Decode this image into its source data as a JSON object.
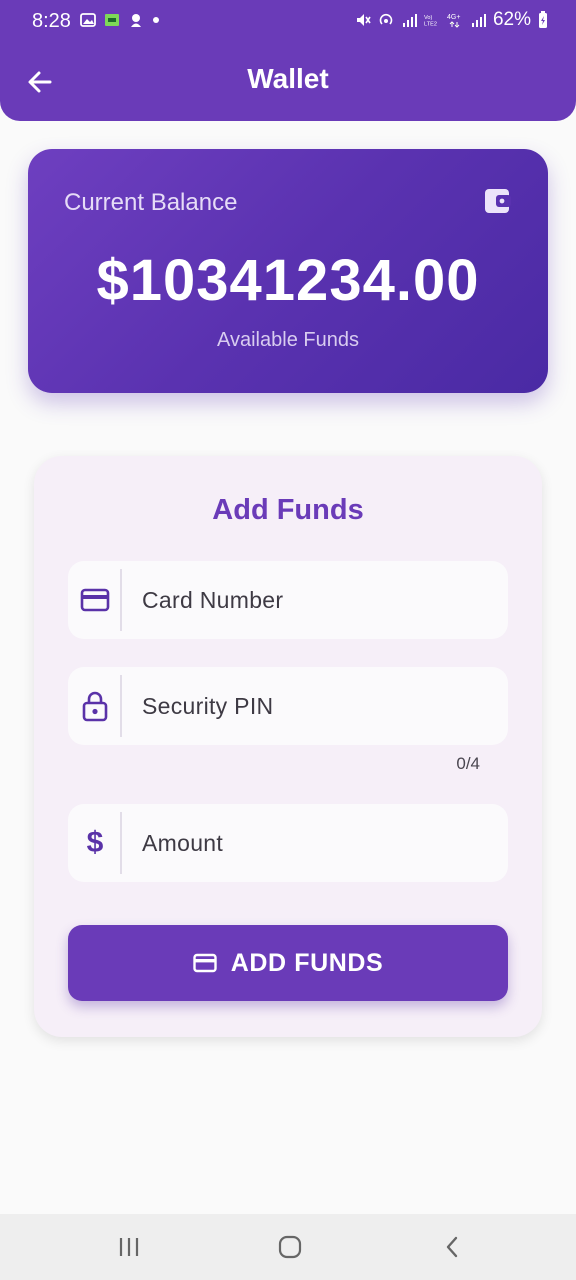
{
  "status_bar": {
    "time": "8:28",
    "battery_percent": "62%"
  },
  "header": {
    "title": "Wallet"
  },
  "balance_card": {
    "label": "Current Balance",
    "amount": "$10341234.00",
    "subtitle": "Available Funds",
    "icon": "wallet-icon"
  },
  "add_funds": {
    "title": "Add Funds",
    "card_number_placeholder": "Card Number",
    "security_pin_placeholder": "Security PIN",
    "pin_counter": "0/4",
    "amount_placeholder": "Amount",
    "button_label": "ADD FUNDS"
  },
  "colors": {
    "primary": "#6a3bb8",
    "background": "#fafafa",
    "card_background": "#f6eff8"
  }
}
